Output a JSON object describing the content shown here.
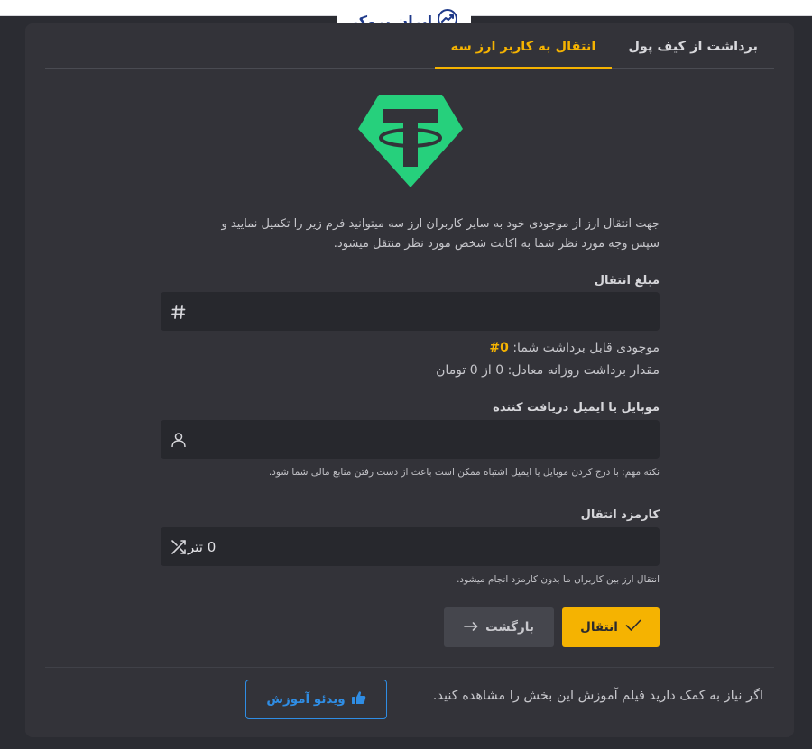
{
  "brand": {
    "name": "ایران بروکر"
  },
  "tabs": [
    {
      "label": "برداشت از کیف پول",
      "active": false
    },
    {
      "label": "انتقال به کاربر ارز سه",
      "active": true
    }
  ],
  "intro": {
    "line1": "جهت انتقال ارز از موجودی خود به سایر کاربران ارز سه میتوانید فرم زیر را تکمیل نمایید و",
    "line2": "سپس وجه مورد نظر شما به اکانت شخص مورد نظر منتقل میشود."
  },
  "amount": {
    "label": "مبلغ انتقال",
    "value": ""
  },
  "balance": {
    "label": "موجودی قابل برداشت شما:",
    "value": "0#"
  },
  "daily_limit": {
    "text": "مقدار برداشت روزانه معادل: 0 از 0 تومان"
  },
  "recipient": {
    "label": "موبایل یا ایمیل دریافت کننده",
    "value": "",
    "note": "نکته مهم: با درج کردن موبایل یا ایمیل اشتباه ممکن است باعث از دست رفتن منابع مالی شما شود."
  },
  "fee": {
    "label": "کارمزد انتقال",
    "value": "0 تتر",
    "note": "انتقال ارز بین کاربران ما بدون کارمزد انجام میشود."
  },
  "buttons": {
    "submit": "انتقال",
    "back": "بازگشت"
  },
  "help": {
    "text": "اگر نیاز به کمک دارید فیلم آموزش این بخش را مشاهده کنید.",
    "video_label": "ویدئو آموزش"
  },
  "colors": {
    "accent": "#f5b301",
    "tether": "#26d07c",
    "link": "#2f8de4"
  }
}
